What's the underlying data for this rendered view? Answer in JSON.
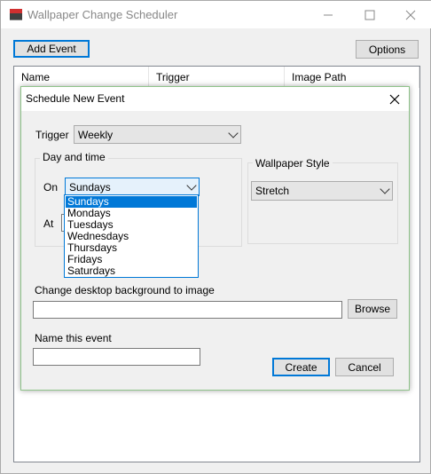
{
  "app": {
    "title": "Wallpaper Change Scheduler",
    "add_event_label": "Add Event",
    "options_label": "Options",
    "columns": [
      "Name",
      "Trigger",
      "Image Path"
    ]
  },
  "dialog": {
    "title": "Schedule New Event",
    "trigger_label": "Trigger",
    "trigger_value": "Weekly",
    "day_time_group": "Day and time",
    "on_label": "On",
    "on_value": "Sundays",
    "at_label": "At",
    "day_options": [
      "Sundays",
      "Mondays",
      "Tuesdays",
      "Wednesdays",
      "Thursdays",
      "Fridays",
      "Saturdays"
    ],
    "selected_day_index": 0,
    "style_group": "Wallpaper Style",
    "style_value": "Stretch",
    "image_label": "Change desktop background to image",
    "image_value": "",
    "browse_label": "Browse",
    "name_label": "Name this event",
    "name_value": "",
    "create_label": "Create",
    "cancel_label": "Cancel"
  },
  "icons": {
    "minimize": "minimize-icon",
    "maximize": "maximize-icon",
    "close": "close-icon",
    "dropdown": "chevron-down-icon"
  },
  "colors": {
    "accent": "#0078d7",
    "dialog_border": "#8fc38a"
  }
}
